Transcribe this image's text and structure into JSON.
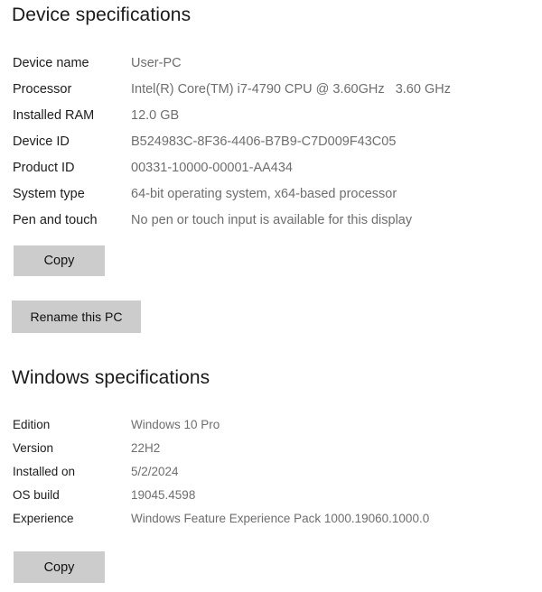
{
  "device_section": {
    "heading": "Device specifications",
    "rows": [
      {
        "label": "Device name",
        "value": "User-PC"
      },
      {
        "label": "Processor",
        "value": "Intel(R) Core(TM) i7-4790 CPU @ 3.60GHz   3.60 GHz"
      },
      {
        "label": "Installed RAM",
        "value": "12.0 GB"
      },
      {
        "label": "Device ID",
        "value": "B524983C-8F36-4406-B7B9-C7D009F43C05"
      },
      {
        "label": "Product ID",
        "value": "00331-10000-00001-AA434"
      },
      {
        "label": "System type",
        "value": "64-bit operating system, x64-based processor"
      },
      {
        "label": "Pen and touch",
        "value": "No pen or touch input is available for this display"
      }
    ],
    "copy_label": "Copy",
    "rename_label": "Rename this PC"
  },
  "windows_section": {
    "heading": "Windows specifications",
    "rows": [
      {
        "label": "Edition",
        "value": "Windows 10 Pro"
      },
      {
        "label": "Version",
        "value": "22H2"
      },
      {
        "label": "Installed on",
        "value": "5/2/2024"
      },
      {
        "label": "OS build",
        "value": "19045.4598"
      },
      {
        "label": "Experience",
        "value": "Windows Feature Experience Pack 1000.19060.1000.0"
      }
    ],
    "copy_label": "Copy"
  },
  "colors": {
    "background": "#ffffff",
    "heading_text": "#1a1a1a",
    "label_text": "#1d1d1d",
    "value_text": "#6e6e6e",
    "button_face": "#cccccc",
    "button_text": "#101010"
  }
}
